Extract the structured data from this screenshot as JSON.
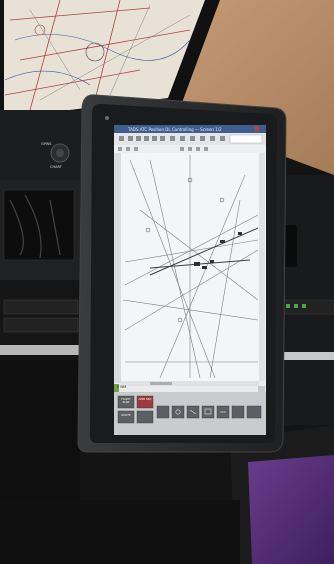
{
  "scene": {
    "description_free": true
  },
  "window": {
    "title": "TADS ATC Position DL Controlling — Screen 1/2"
  },
  "map": {
    "scale_label": "5 NM"
  },
  "console": {
    "top_label": "GPWS",
    "knob_label": "CHART"
  },
  "bottom_buttons": [
    {
      "label": "FLIGHT PLAN"
    },
    {
      "label": "APPR SEQ"
    },
    {
      "label": "ROUTE"
    },
    {
      "label": ""
    },
    {
      "label": ""
    },
    {
      "label": ""
    },
    {
      "label": ""
    },
    {
      "label": ""
    },
    {
      "label": ""
    },
    {
      "label": ""
    }
  ],
  "colors": {
    "wall": "#b98e68",
    "bezel": "#2b2d2e",
    "screen_bg": "#f1f3f4",
    "titlebar": "#3f5e8e",
    "accent_button": "#9b3b3b"
  }
}
